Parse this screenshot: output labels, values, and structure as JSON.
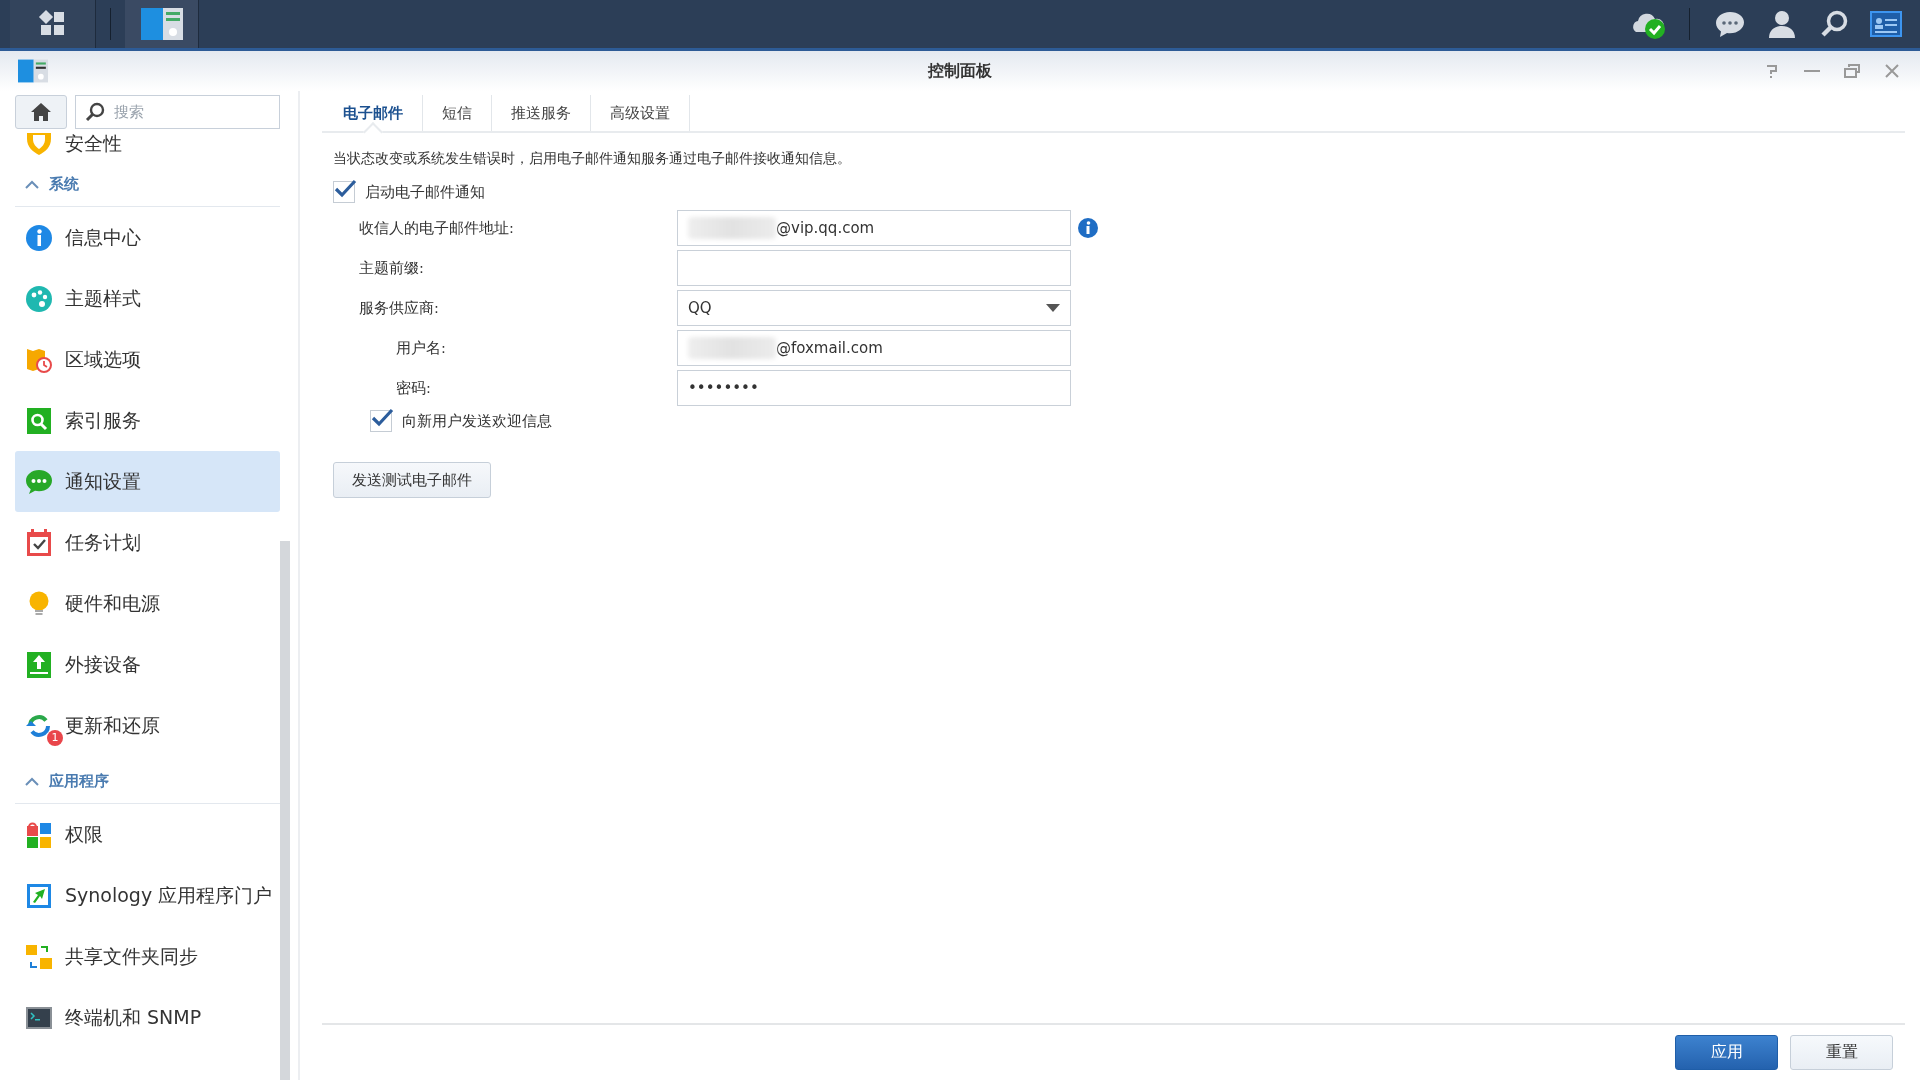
{
  "window": {
    "title": "控制面板"
  },
  "sidebar": {
    "search": {
      "placeholder": "搜索"
    },
    "partial_item": {
      "label": "安全性"
    },
    "sections": [
      {
        "title": "系统",
        "expanded": true,
        "items": [
          {
            "label": "信息中心",
            "selected": false
          },
          {
            "label": "主题样式",
            "selected": false
          },
          {
            "label": "区域选项",
            "selected": false
          },
          {
            "label": "索引服务",
            "selected": false
          },
          {
            "label": "通知设置",
            "selected": true
          },
          {
            "label": "任务计划",
            "selected": false
          },
          {
            "label": "硬件和电源",
            "selected": false
          },
          {
            "label": "外接设备",
            "selected": false
          },
          {
            "label": "更新和还原",
            "selected": false,
            "badge": "1"
          }
        ]
      },
      {
        "title": "应用程序",
        "expanded": true,
        "items": [
          {
            "label": "权限",
            "selected": false
          },
          {
            "label": "Synology 应用程序门户",
            "selected": false
          },
          {
            "label": "共享文件夹同步",
            "selected": false
          },
          {
            "label": "终端机和 SNMP",
            "selected": false
          }
        ]
      }
    ]
  },
  "tabs": [
    {
      "label": "电子邮件",
      "selected": true
    },
    {
      "label": "短信",
      "selected": false
    },
    {
      "label": "推送服务",
      "selected": false
    },
    {
      "label": "高级设置",
      "selected": false
    }
  ],
  "description": "当状态改变或系统发生错误时，启用电子邮件通知服务通过电子邮件接收通知信息。",
  "enable_checkbox": {
    "label": "启动电子邮件通知",
    "checked": true
  },
  "fields": [
    {
      "kind": "text",
      "label": "收信人的电子邮件地址:",
      "value": "@vip.qq.com",
      "indent": false,
      "redacted": true,
      "info": true
    },
    {
      "kind": "text",
      "label": "主题前缀:",
      "indent": false
    },
    {
      "kind": "select",
      "label": "服务供应商:",
      "value": "QQ",
      "indent": false
    },
    {
      "kind": "text",
      "label": "用户名:",
      "value": "@foxmail.com",
      "indent": true,
      "redacted": true
    },
    {
      "kind": "text",
      "label": "密码:",
      "value": "••••••••",
      "indent": true
    }
  ],
  "welcome_checkbox": {
    "label": "向新用户发送欢迎信息",
    "checked": true
  },
  "test_button": "发送测试电子邮件",
  "footer_buttons": [
    {
      "label": "应用",
      "kind": "primary"
    },
    {
      "label": "重置",
      "kind": "secondary"
    }
  ]
}
